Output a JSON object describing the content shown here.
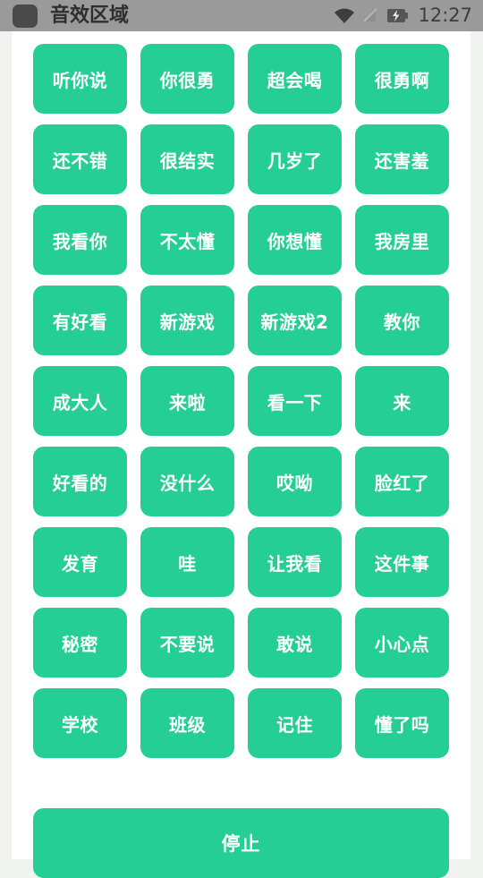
{
  "status_bar": {
    "app_icon": "app-square-icon",
    "title": "音效区域",
    "icons": [
      "wifi-icon",
      "signal-off-icon",
      "battery-charging-icon"
    ],
    "clock": "12:27",
    "background_color": "#9a9a9a"
  },
  "theme": {
    "accent_color": "#25ce95",
    "button_text_color": "#ffffff",
    "page_background": "#f1f3f1",
    "card_background": "#ffffff"
  },
  "main": {
    "buttons": [
      {
        "label": "听你说"
      },
      {
        "label": "你很勇"
      },
      {
        "label": "超会喝"
      },
      {
        "label": "很勇啊"
      },
      {
        "label": "还不错"
      },
      {
        "label": "很结实"
      },
      {
        "label": "几岁了"
      },
      {
        "label": "还害羞"
      },
      {
        "label": "我看你"
      },
      {
        "label": "不太懂"
      },
      {
        "label": "你想懂"
      },
      {
        "label": "我房里"
      },
      {
        "label": "有好看"
      },
      {
        "label": "新游戏"
      },
      {
        "label": "新游戏2"
      },
      {
        "label": "教你"
      },
      {
        "label": "成大人"
      },
      {
        "label": "来啦"
      },
      {
        "label": "看一下"
      },
      {
        "label": "来"
      },
      {
        "label": "好看的"
      },
      {
        "label": "没什么"
      },
      {
        "label": "哎呦"
      },
      {
        "label": "脸红了"
      },
      {
        "label": "发育"
      },
      {
        "label": "哇"
      },
      {
        "label": "让我看"
      },
      {
        "label": "这件事"
      },
      {
        "label": "秘密"
      },
      {
        "label": "不要说"
      },
      {
        "label": "敢说"
      },
      {
        "label": "小心点"
      },
      {
        "label": "学校"
      },
      {
        "label": "班级"
      },
      {
        "label": "记住"
      },
      {
        "label": "懂了吗"
      }
    ],
    "stop_button": {
      "label": "停止"
    }
  }
}
